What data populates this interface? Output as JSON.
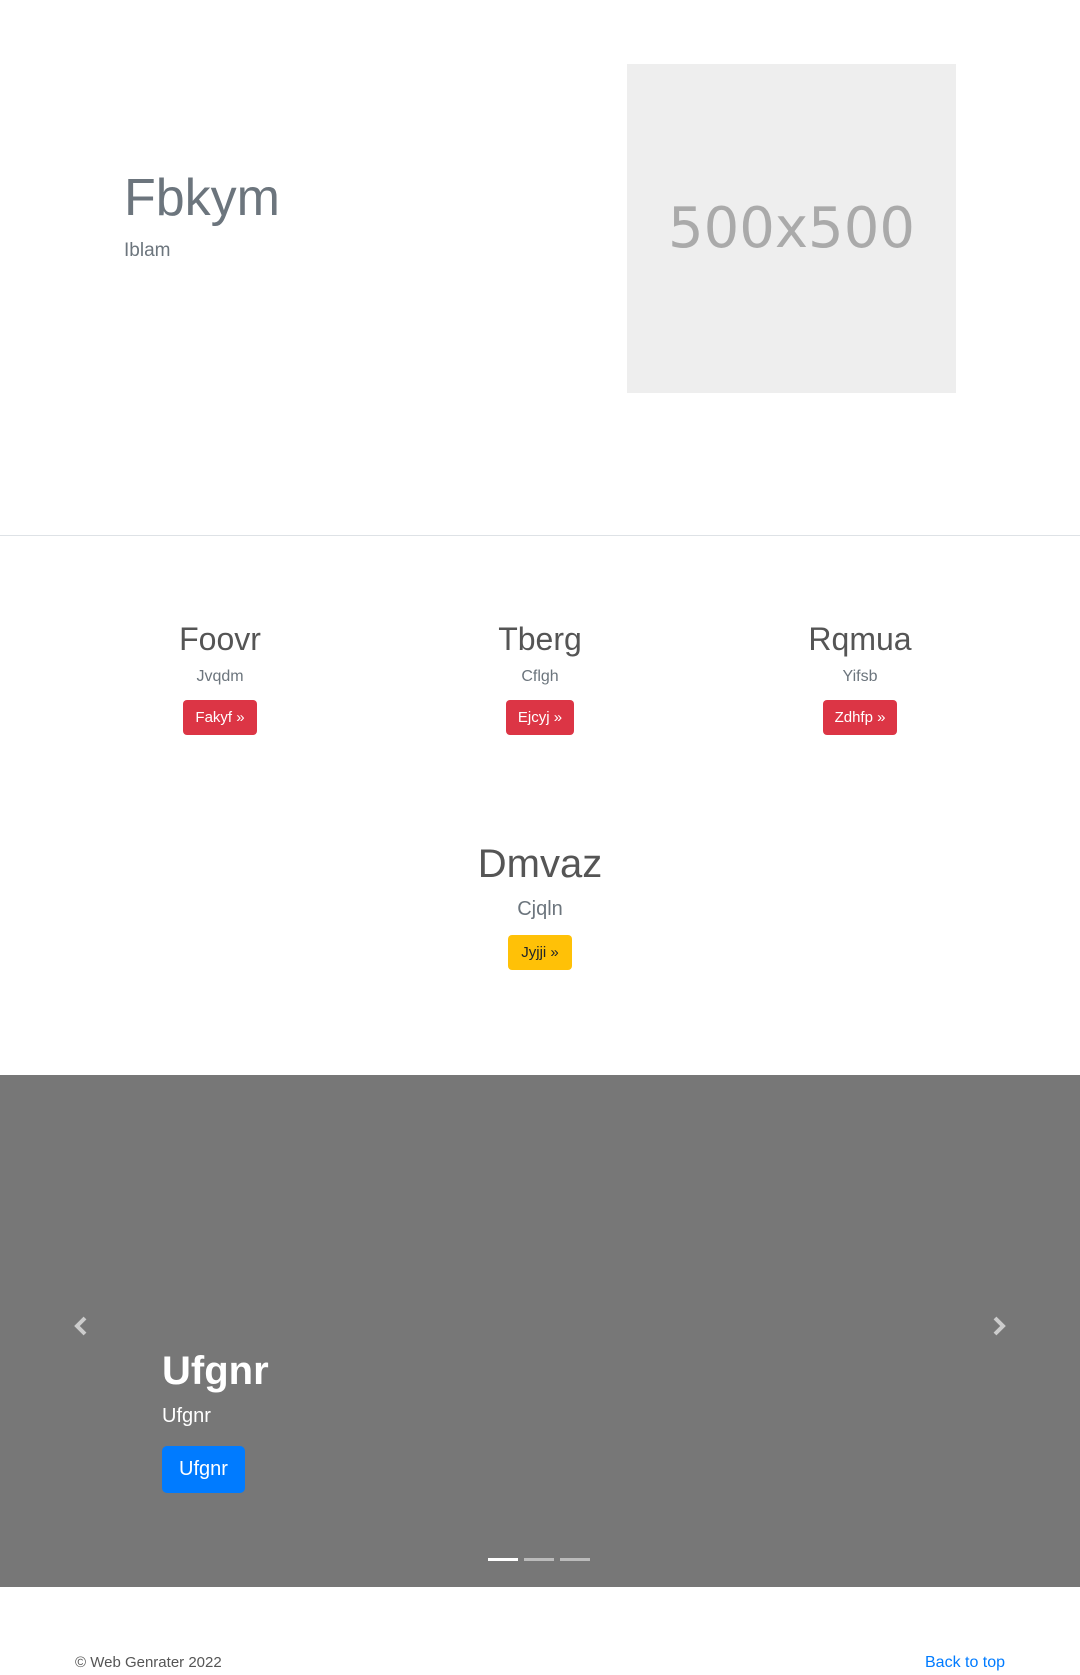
{
  "hero": {
    "title": "Fbkym",
    "subtitle": "Iblam",
    "image_placeholder": "500x500"
  },
  "features": [
    {
      "title": "Foovr",
      "text": "Jvqdm",
      "button": "Fakyf »"
    },
    {
      "title": "Tberg",
      "text": "Cflgh",
      "button": "Ejcyj »"
    },
    {
      "title": "Rqmua",
      "text": "Yifsb",
      "button": "Zdhfp »"
    }
  ],
  "feature_center": {
    "title": "Dmvaz",
    "text": "Cjqln",
    "button": "Jyjji »"
  },
  "carousel": {
    "heading": "Ufgnr",
    "text": "Ufgnr",
    "button": "Ufgnr",
    "prev_icon": "chevron-left-icon",
    "next_icon": "chevron-right-icon",
    "slide_count": 3,
    "active_slide": 1
  },
  "footer": {
    "copyright": "© Web Genrater 2022",
    "back_to_top": "Back to top"
  },
  "colors": {
    "danger": "#dc3545",
    "warning": "#ffc107",
    "primary": "#007bff",
    "carousel_bg": "#777777",
    "placeholder_bg": "#eeeeee"
  }
}
